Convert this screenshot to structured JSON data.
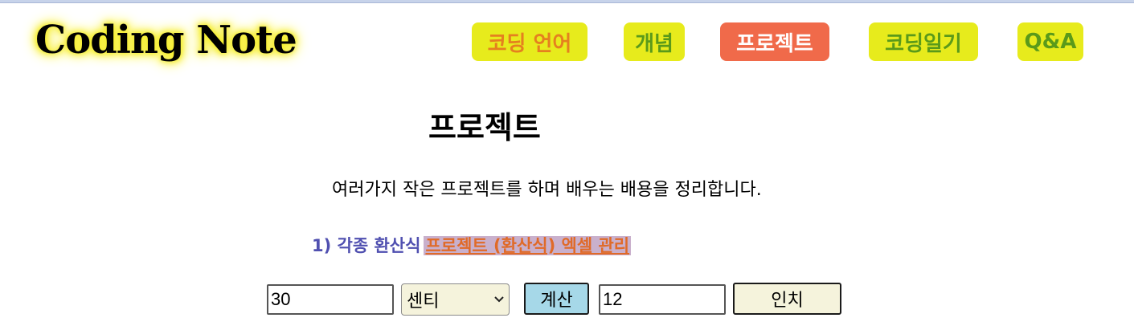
{
  "header": {
    "logo": "Coding Note",
    "nav": {
      "coding_language": "코딩 언어",
      "concept": "개념",
      "project": "프로젝트",
      "coding_diary": "코딩일기",
      "qa": "Q&A"
    },
    "active_nav": "project"
  },
  "main": {
    "title": "프로젝트",
    "intro": "여러가지 작은 프로젝트를 하며 배우는 배용을 정리합니다.",
    "section": {
      "number_label": "1) 각종 환산식",
      "link_label": "프로젝트 (환산식) 엑셀 관리"
    }
  },
  "converter": {
    "input_value": "30",
    "unit_selected": "센티",
    "calc_label": "계산",
    "result_value": "12",
    "result_unit_label": "인치"
  },
  "colors": {
    "nav_bg": "#e7eb1c",
    "nav_active_bg": "#f06a4a",
    "nav_orange_text": "#e5801f",
    "nav_green_text": "#5a9a1a",
    "section_number": "#5050b0",
    "section_link": "#e06a28",
    "section_link_bg": "#c9b0cc",
    "calc_button_bg": "#a6d8e8",
    "logo_glow": "#f6ee2a"
  },
  "icons": {
    "select_arrow": "chevron-down-icon"
  }
}
